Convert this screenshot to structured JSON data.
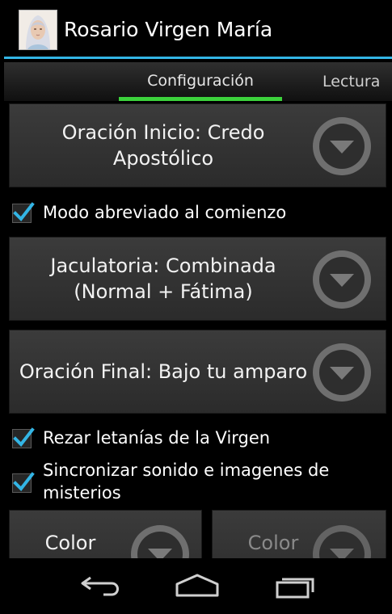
{
  "actionbar": {
    "title": "Rosario Virgen María",
    "icon": "virgin-mary-portrait"
  },
  "tabs": [
    {
      "label": "Configuración",
      "selected": true
    },
    {
      "label": "Lectura",
      "selected": false
    }
  ],
  "settings": {
    "oracion_inicio": {
      "label": "Oración Inicio: Credo Apostólico"
    },
    "modo_abreviado": {
      "label": "Modo abreviado al comienzo",
      "checked": true
    },
    "jaculatoria": {
      "label": "Jaculatoria:  Combinada (Normal + Fátima)"
    },
    "oracion_final": {
      "label": "Oración Final:  Bajo tu amparo"
    },
    "rezar_letanias": {
      "label": "Rezar letanías de la Virgen",
      "checked": true
    },
    "sincronizar": {
      "label": "Sincronizar sonido e imagenes de misterios",
      "checked": true
    },
    "color_left": {
      "label": "Color"
    },
    "color_right": {
      "label": "Color",
      "enabled": false
    }
  },
  "navbar": {
    "back_icon": "back-arrow-icon",
    "home_icon": "home-icon",
    "recents_icon": "recent-apps-icon"
  },
  "colors": {
    "accent_blue": "#33b5e5",
    "tab_indicator": "#3cd23c",
    "checkbox": "#33b5e5"
  }
}
